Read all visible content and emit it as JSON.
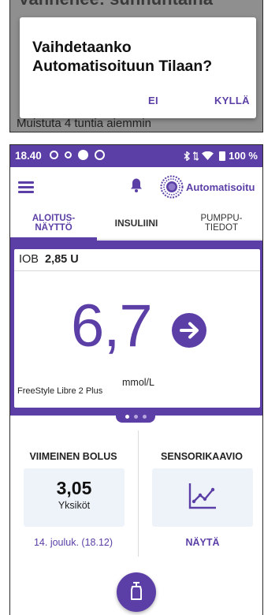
{
  "dialog": {
    "background_header": "Vanhenee: sunnuntaina",
    "background_footer": "Muistuta 4 tuntia aiemmin",
    "title": "Vaihdetaanko Automatisoituun Tilaan?",
    "no_label": "EI",
    "yes_label": "KYLLÄ"
  },
  "status_bar": {
    "time": "18.40",
    "battery": "100 %"
  },
  "app_bar": {
    "mode_label": "Automatisoitu"
  },
  "tabs": [
    {
      "label": "ALOITUS-\nNÄYTTÖ",
      "active": true
    },
    {
      "label": "INSULIINI",
      "active": false
    },
    {
      "label": "PUMPPU-\nTIEDOT",
      "active": false
    }
  ],
  "glucose": {
    "iob_label": "IOB",
    "iob_value": "2,85 U",
    "value": "6,7",
    "unit": "mmol/L",
    "sensor_name": "FreeStyle Libre 2 Plus"
  },
  "pager": {
    "pages": 3,
    "current": 1
  },
  "last_bolus": {
    "title": "VIIMEINEN BOLUS",
    "value": "3,05",
    "unit": "Yksiköt",
    "date": "14. jouluk. (18.12)"
  },
  "sensor_graph": {
    "title": "SENSORIKAAVIO",
    "show_label": "NÄYTÄ"
  },
  "colors": {
    "accent": "#5b3fa6",
    "card_background": "#eef3f9"
  }
}
